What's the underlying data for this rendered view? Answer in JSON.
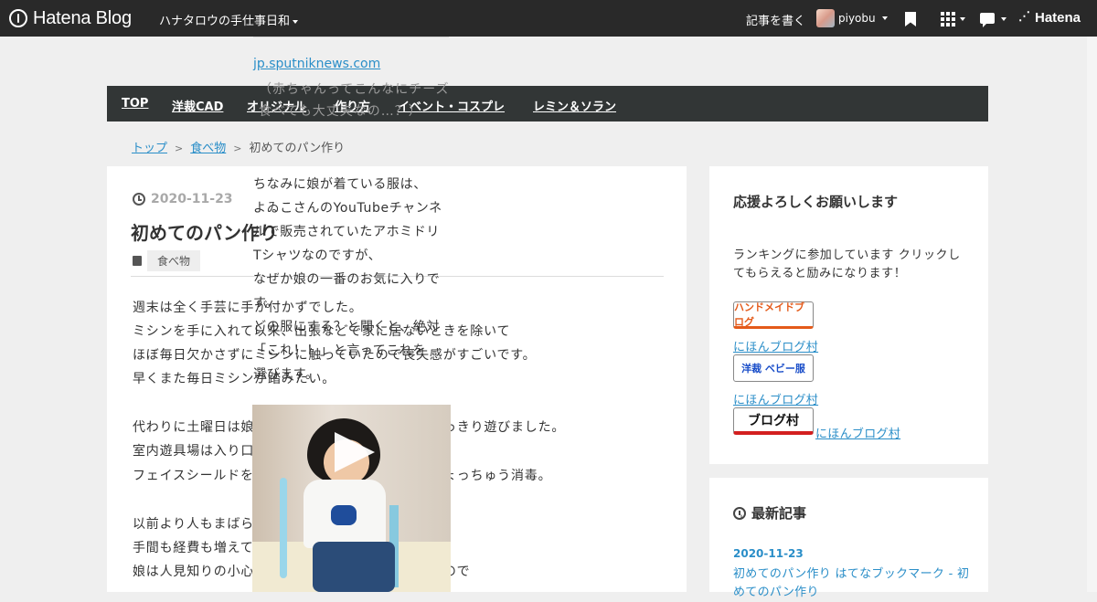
{
  "topbar": {
    "logo": "Hatena Blog",
    "blog_name": "ハナタロウの手仕事日和",
    "write_label": "記事を書く",
    "username": "piyobu",
    "brand": "Hatena"
  },
  "overlay": {
    "link": "jp.sputniknews.com",
    "ghost": "（赤ちゃんってこんなにチーズ食べても大丈夫なの…？）",
    "lines": [
      "ちなみに娘が着ている服は、",
      "よゐこさんのYouTubeチャンネ",
      "ルで販売されていたアホミドリ",
      "Tシャツなのですが、",
      "なぜか娘の一番のお気に入りで",
      "す。",
      "どの服にする？と聞くと、絶対",
      "「これ！！」と言ってこれを",
      "選びます。"
    ]
  },
  "nav": {
    "items": [
      "TOP",
      "洋裁CAD",
      "オリジナル",
      "作り方",
      "イベント・コスプレ",
      "レミン＆ソラン"
    ]
  },
  "breadcrumb": {
    "home": "トップ",
    "category": "食べ物",
    "current": "初めてのパン作り",
    "sep": ">"
  },
  "article": {
    "date": "2020-11-23",
    "title": "初めてのパン作り",
    "category": "食べ物",
    "paragraphs": [
      "週末は全く手芸に手が付かずでした。",
      "ミシンを手に入れて以来、出張などで家に居ないときを除いて",
      "ほぼ毎日欠かさずにミシンに触っていたので喪失感がすごいです。",
      "早くまた毎日ミシンが踏みたい。",
      "代わりに土曜日は娘を連れて室内遊具場へ行き思いっきり遊びました。",
      "室内遊具場は入り口で検温があり",
      "フェイスシールドを付けたスタッフさんが換気＆しょっちゅう消毒。",
      "以前より人もまばらで",
      "手間も経費も増えて運営側も大変ですよね。",
      "娘は人見知りの小心者なので、のびのびと遊べないので"
    ]
  },
  "sidebar": {
    "support_title": "応援よろしくお願いします",
    "support_text": "ランキングに参加しています クリックしてもらえると励みになります！",
    "banners": [
      "ハンドメイドブログ",
      "洋裁 ベビー服",
      "ブログ村"
    ],
    "links": [
      "にほんブログ村",
      "にほんブログ村",
      "にほんブログ村"
    ],
    "recent_title": "最新記事",
    "recent_date": "2020-11-23",
    "recent_entry": "初めてのパン作り",
    "recent_bookmark": "はてなブックマーク - 初めてのパン作り"
  }
}
